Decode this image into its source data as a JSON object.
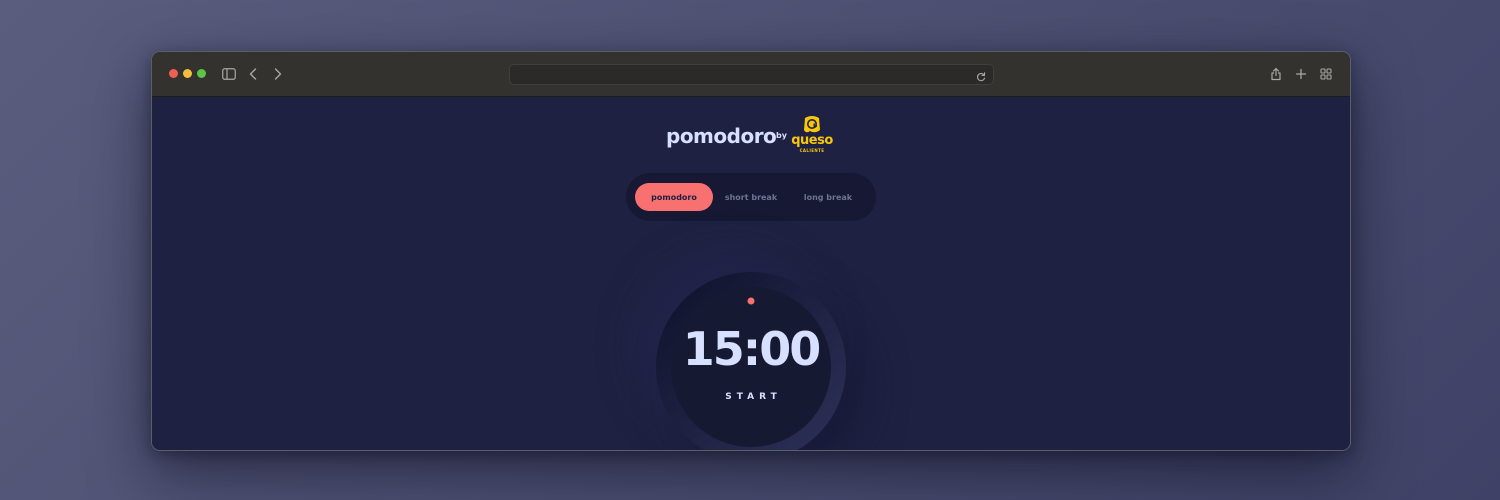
{
  "browser": {
    "url": "",
    "icons": {
      "sidebar": "sidebar-icon",
      "back": "chevron-left-icon",
      "forward": "chevron-right-icon",
      "reload": "reload-icon",
      "share": "share-icon",
      "new_tab": "plus-icon",
      "tab_overview": "grid-icon"
    }
  },
  "header": {
    "title": "pomodoro",
    "by": "by",
    "logo": {
      "word": "queso",
      "sub": "CALIENTE",
      "color": "#f8c70b"
    }
  },
  "mode_tabs": [
    {
      "label": "pomodoro",
      "active": true
    },
    {
      "label": "short break",
      "active": false
    },
    {
      "label": "long break",
      "active": false
    }
  ],
  "timer": {
    "time": "15:00",
    "action": "START",
    "progress": 1.0,
    "accent_color": "#f87070"
  },
  "colors": {
    "background": "#1f2142",
    "text": "#d7e0fe",
    "accent": "#f87070",
    "muted": "#6e7396"
  }
}
